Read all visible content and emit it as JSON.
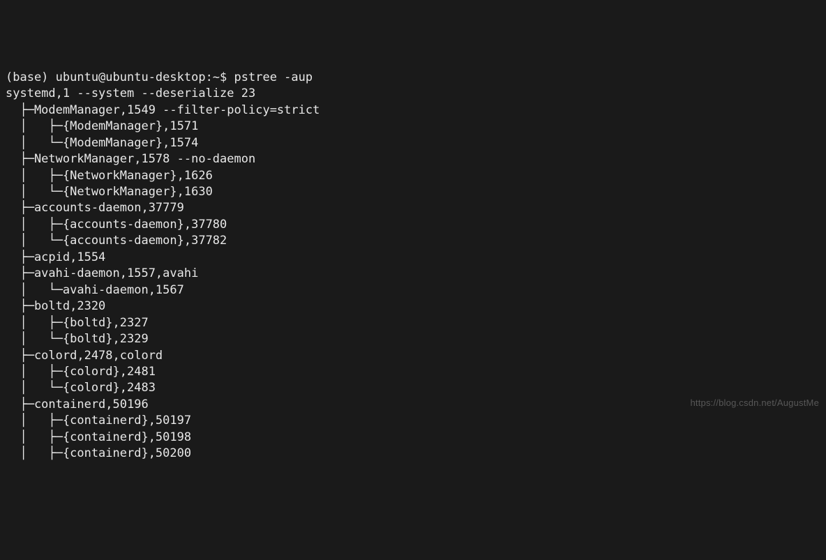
{
  "prompt": {
    "prefix": "(base) ubuntu@ubuntu-desktop:~$ ",
    "command": "pstree -aup"
  },
  "tree": [
    "systemd,1 --system --deserialize 23",
    "  ├─ModemManager,1549 --filter-policy=strict",
    "  │   ├─{ModemManager},1571",
    "  │   └─{ModemManager},1574",
    "  ├─NetworkManager,1578 --no-daemon",
    "  │   ├─{NetworkManager},1626",
    "  │   └─{NetworkManager},1630",
    "  ├─accounts-daemon,37779",
    "  │   ├─{accounts-daemon},37780",
    "  │   └─{accounts-daemon},37782",
    "  ├─acpid,1554",
    "  ├─avahi-daemon,1557,avahi",
    "  │   └─avahi-daemon,1567",
    "  ├─boltd,2320",
    "  │   ├─{boltd},2327",
    "  │   └─{boltd},2329",
    "  ├─colord,2478,colord",
    "  │   ├─{colord},2481",
    "  │   └─{colord},2483",
    "  ├─containerd,50196",
    "  │   ├─{containerd},50197",
    "  │   ├─{containerd},50198",
    "  │   ├─{containerd},50200"
  ],
  "watermark": "https://blog.csdn.net/AugustMe"
}
